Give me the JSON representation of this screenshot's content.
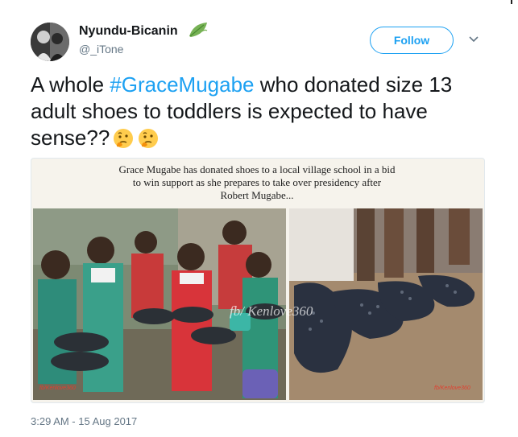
{
  "author": {
    "display_name": "Nyundu-Bicanin",
    "handle": "@_iTone",
    "badge_icon": "leaf-icon"
  },
  "follow_label": "Follow",
  "menu_icon": "chevron-down-icon",
  "tweet": {
    "text_before": "A whole ",
    "hashtag": "#GraceMugabe",
    "text_after": " who donated size 13 adult shoes to toddlers is expected to have sense??",
    "emojis": [
      "thinking-face-emoji",
      "thinking-face-emoji"
    ]
  },
  "media": {
    "caption_lines": [
      "Grace Mugabe has donated shoes to a local  village school in a bid",
      "to win support as she prepares to take over presidency after",
      "Robert Mugabe..."
    ],
    "watermark": "fb/ Kenlove360",
    "stamp_left": "fb/Kenlove360",
    "stamp_right": "fb/Kenlove360"
  },
  "timestamp": "3:29 AM - 15 Aug 2017",
  "colors": {
    "brand_blue": "#1da1f2",
    "text_primary": "#14171a",
    "text_secondary": "#657786"
  }
}
